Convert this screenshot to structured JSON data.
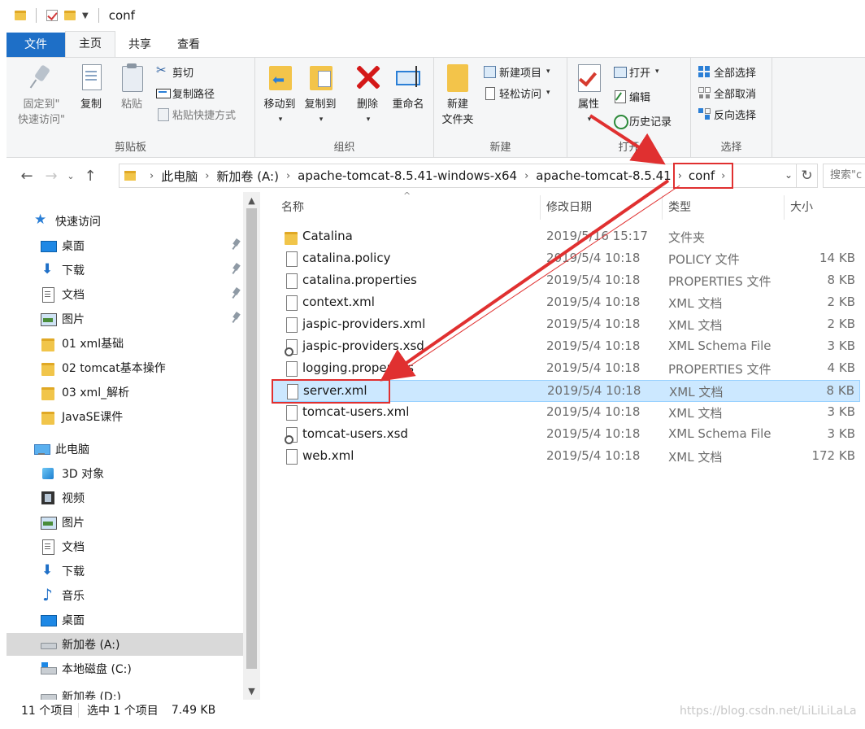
{
  "window": {
    "title": "conf"
  },
  "ribbon": {
    "tabs": [
      {
        "label": "文件"
      },
      {
        "label": "主页"
      },
      {
        "label": "共享"
      },
      {
        "label": "查看"
      }
    ],
    "clipboard": {
      "group_label": "剪贴板",
      "pin_label_1": "固定到\"",
      "pin_label_2": "快速访问\"",
      "copy_label": "复制",
      "paste_label": "粘贴",
      "cut_label": "剪切",
      "copy_path_label": "复制路径",
      "paste_shortcut_label": "粘贴快捷方式"
    },
    "organize": {
      "group_label": "组织",
      "move_label": "移动到",
      "copy_to_label": "复制到",
      "delete_label": "删除",
      "rename_label": "重命名"
    },
    "new": {
      "group_label": "新建",
      "new_folder_label_1": "新建",
      "new_folder_label_2": "文件夹",
      "new_item_label": "新建项目",
      "easy_access_label": "轻松访问"
    },
    "open": {
      "group_label": "打开",
      "properties_label": "属性",
      "open_label": "打开",
      "edit_label": "编辑",
      "history_label": "历史记录"
    },
    "select": {
      "group_label": "选择",
      "select_all_label": "全部选择",
      "select_none_label": "全部取消",
      "invert_label": "反向选择"
    }
  },
  "address": {
    "crumbs": [
      "此电脑",
      "新加卷 (A:)",
      "apache-tomcat-8.5.41-windows-x64",
      "apache-tomcat-8.5.41"
    ],
    "current": "conf",
    "search_placeholder": "搜索\"c"
  },
  "navpane": {
    "items": [
      {
        "label": "快速访问",
        "icon": "star-icon"
      },
      {
        "label": "桌面",
        "icon": "desktop-icon",
        "pinned": true
      },
      {
        "label": "下载",
        "icon": "download-icon",
        "pinned": true
      },
      {
        "label": "文档",
        "icon": "documents-icon",
        "pinned": true
      },
      {
        "label": "图片",
        "icon": "pictures-icon",
        "pinned": true
      },
      {
        "label": "01 xml基础",
        "icon": "folder-icon"
      },
      {
        "label": "02 tomcat基本操作",
        "icon": "folder-icon"
      },
      {
        "label": "03 xml_解析",
        "icon": "folder-icon"
      },
      {
        "label": "JavaSE课件",
        "icon": "folder-icon"
      },
      {
        "label": "此电脑",
        "icon": "this-pc-icon"
      },
      {
        "label": "3D 对象",
        "icon": "3d-objects-icon"
      },
      {
        "label": "视频",
        "icon": "video-icon"
      },
      {
        "label": "图片",
        "icon": "pictures-icon"
      },
      {
        "label": "文档",
        "icon": "documents-icon"
      },
      {
        "label": "下载",
        "icon": "download-icon"
      },
      {
        "label": "音乐",
        "icon": "music-icon"
      },
      {
        "label": "桌面",
        "icon": "desktop-icon"
      },
      {
        "label": "新加卷 (A:)",
        "icon": "drive-icon",
        "selected": true
      },
      {
        "label": "本地磁盘 (C:)",
        "icon": "local-disk-icon"
      },
      {
        "label": "新加卷 (D:)",
        "icon": "drive-icon"
      }
    ]
  },
  "columns": {
    "name": "名称",
    "date": "修改日期",
    "type": "类型",
    "size": "大小"
  },
  "files": [
    {
      "name": "Catalina",
      "date": "2019/5/16 15:17",
      "type": "文件夹",
      "size": "",
      "icon": "folder-icon"
    },
    {
      "name": "catalina.policy",
      "date": "2019/5/4 10:18",
      "type": "POLICY 文件",
      "size": "14 KB",
      "icon": "file-icon"
    },
    {
      "name": "catalina.properties",
      "date": "2019/5/4 10:18",
      "type": "PROPERTIES 文件",
      "size": "8 KB",
      "icon": "file-icon"
    },
    {
      "name": "context.xml",
      "date": "2019/5/4 10:18",
      "type": "XML 文档",
      "size": "2 KB",
      "icon": "file-icon"
    },
    {
      "name": "jaspic-providers.xml",
      "date": "2019/5/4 10:18",
      "type": "XML 文档",
      "size": "2 KB",
      "icon": "file-icon"
    },
    {
      "name": "jaspic-providers.xsd",
      "date": "2019/5/4 10:18",
      "type": "XML Schema File",
      "size": "3 KB",
      "icon": "xsd-file-icon"
    },
    {
      "name": "logging.properties",
      "date": "2019/5/4 10:18",
      "type": "PROPERTIES 文件",
      "size": "4 KB",
      "icon": "file-icon"
    },
    {
      "name": "server.xml",
      "date": "2019/5/4 10:18",
      "type": "XML 文档",
      "size": "8 KB",
      "icon": "file-icon",
      "selected": true
    },
    {
      "name": "tomcat-users.xml",
      "date": "2019/5/4 10:18",
      "type": "XML 文档",
      "size": "3 KB",
      "icon": "file-icon"
    },
    {
      "name": "tomcat-users.xsd",
      "date": "2019/5/4 10:18",
      "type": "XML Schema File",
      "size": "3 KB",
      "icon": "xsd-file-icon"
    },
    {
      "name": "web.xml",
      "date": "2019/5/4 10:18",
      "type": "XML 文档",
      "size": "172 KB",
      "icon": "file-icon"
    }
  ],
  "status": {
    "count": "11 个项目",
    "selection": "选中 1 个项目",
    "size": "7.49 KB"
  },
  "watermark": "https://blog.csdn.net/LiLiLiLaLa",
  "colors": {
    "accent": "#1e6fc7",
    "selection_bg": "#cce8ff",
    "annotation_red": "#e03030"
  }
}
